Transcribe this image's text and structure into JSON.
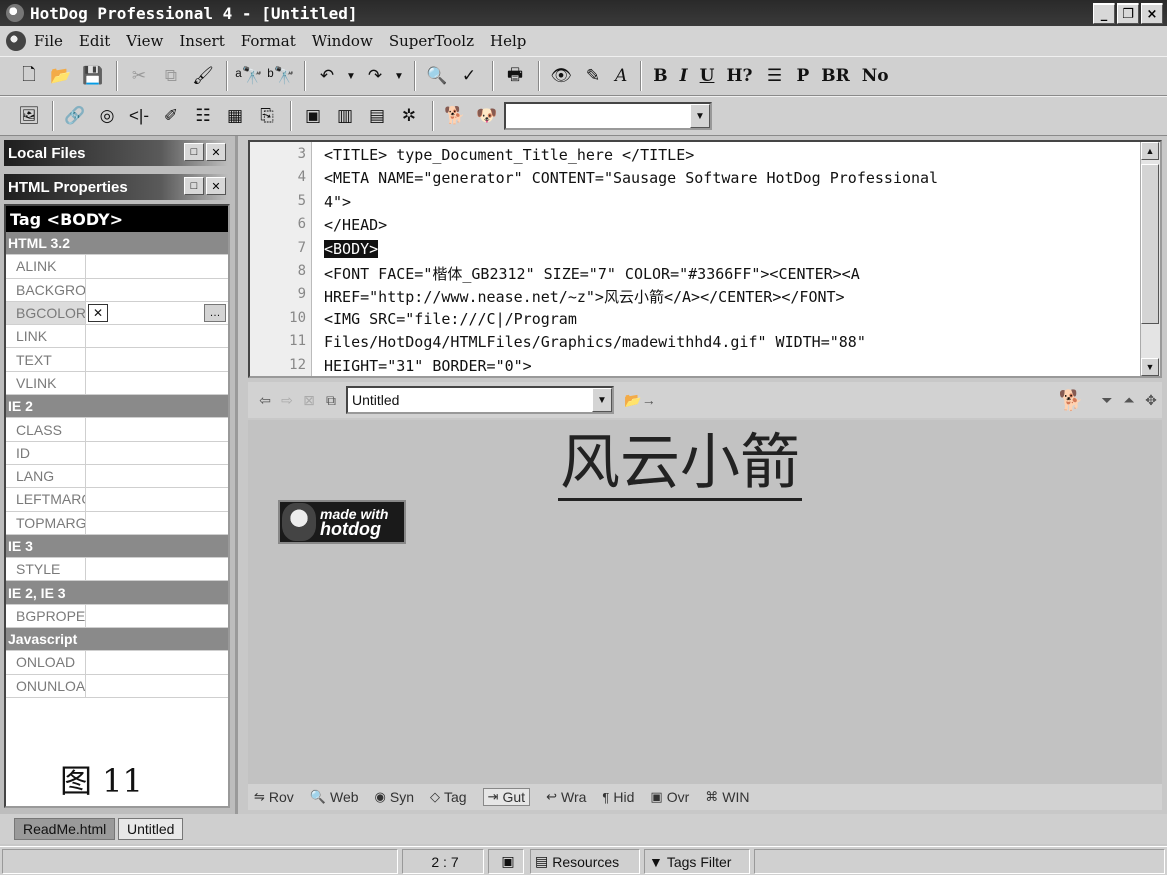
{
  "window": {
    "title": "HotDog Professional 4 - [Untitled]",
    "minimize": "_",
    "restore": "❐",
    "close": "×"
  },
  "menu": {
    "items": [
      {
        "label": "File"
      },
      {
        "label": "Edit"
      },
      {
        "label": "View"
      },
      {
        "label": "Insert"
      },
      {
        "label": "Format"
      },
      {
        "label": "Window"
      },
      {
        "label": "SuperToolz"
      },
      {
        "label": "Help"
      }
    ]
  },
  "toolbar1": {
    "heading_help": "H?",
    "para": "P",
    "br": "BR",
    "nobr": "No",
    "bold": "B",
    "italic": "I",
    "underline": "U",
    "font": "A"
  },
  "toolbar2": {
    "combo_value": ""
  },
  "left_panel": {
    "local_files_title": "Local Files",
    "html_props_title": "HTML Properties",
    "tag_title": "Tag <BODY>",
    "rows": [
      {
        "name": "HTML 3.2",
        "group": true
      },
      {
        "name": "ALINK"
      },
      {
        "name": "BACKGROUND"
      },
      {
        "name": "BGCOLOR",
        "active": true
      },
      {
        "name": "LINK"
      },
      {
        "name": "TEXT"
      },
      {
        "name": "VLINK"
      },
      {
        "name": "IE 2",
        "group": true
      },
      {
        "name": "CLASS"
      },
      {
        "name": "ID"
      },
      {
        "name": "LANG"
      },
      {
        "name": "LEFTMARGIN"
      },
      {
        "name": "TOPMARGIN"
      },
      {
        "name": "IE 3",
        "group": true
      },
      {
        "name": "STYLE"
      },
      {
        "name": "IE 2, IE 3",
        "group": true
      },
      {
        "name": "BGPROPERTIES"
      },
      {
        "name": "Javascript",
        "group": true
      },
      {
        "name": "ONLOAD"
      },
      {
        "name": "ONUNLOAD"
      }
    ],
    "figure_label": "图 11"
  },
  "editor": {
    "lines": [
      {
        "n": "3",
        "text": "<TITLE> type_Document_Title_here </TITLE>"
      },
      {
        "n": "4",
        "text": "<META NAME=\"generator\" CONTENT=\"Sausage Software HotDog Professional"
      },
      {
        "n": "5",
        "text": "4\">"
      },
      {
        "n": "6",
        "text": "</HEAD>"
      },
      {
        "n": "7",
        "text": "<BODY>",
        "highlight": true
      },
      {
        "n": "8",
        "text": "<FONT FACE=\"楷体_GB2312\" SIZE=\"7\" COLOR=\"#3366FF\"><CENTER><A"
      },
      {
        "n": "9",
        "text": "HREF=\"http://www.nease.net/~z\">风云小箭</A></CENTER></FONT>"
      },
      {
        "n": "10",
        "text": "<IMG SRC=\"file:///C|/Program"
      },
      {
        "n": "11",
        "text": "Files/HotDog4/HTMLFiles/Graphics/madewithhd4.gif\" WIDTH=\"88\""
      },
      {
        "n": "12",
        "text": "HEIGHT=\"31\" BORDER=\"0\">"
      }
    ]
  },
  "preview_bar": {
    "combo_value": "Untitled"
  },
  "preview": {
    "heading": "风云小箭",
    "badge_line1": "made with",
    "badge_line2": "hotdog"
  },
  "modes": [
    {
      "label": "Rov",
      "icon": "⇋"
    },
    {
      "label": "Web",
      "icon": "🔍"
    },
    {
      "label": "Syn",
      "icon": "◉"
    },
    {
      "label": "Tag",
      "icon": "◇"
    },
    {
      "label": "Gut",
      "icon": "⇥",
      "active": true
    },
    {
      "label": "Wra",
      "icon": "↩"
    },
    {
      "label": "Hid",
      "icon": "¶"
    },
    {
      "label": "Ovr",
      "icon": "▣"
    },
    {
      "label": "WIN",
      "icon": "⌘"
    }
  ],
  "doc_tabs": {
    "readme": "ReadMe.html",
    "untitled": "Untitled"
  },
  "status": {
    "position": "2 : 7",
    "resources": "Resources",
    "tags_filter": "Tags Filter"
  }
}
